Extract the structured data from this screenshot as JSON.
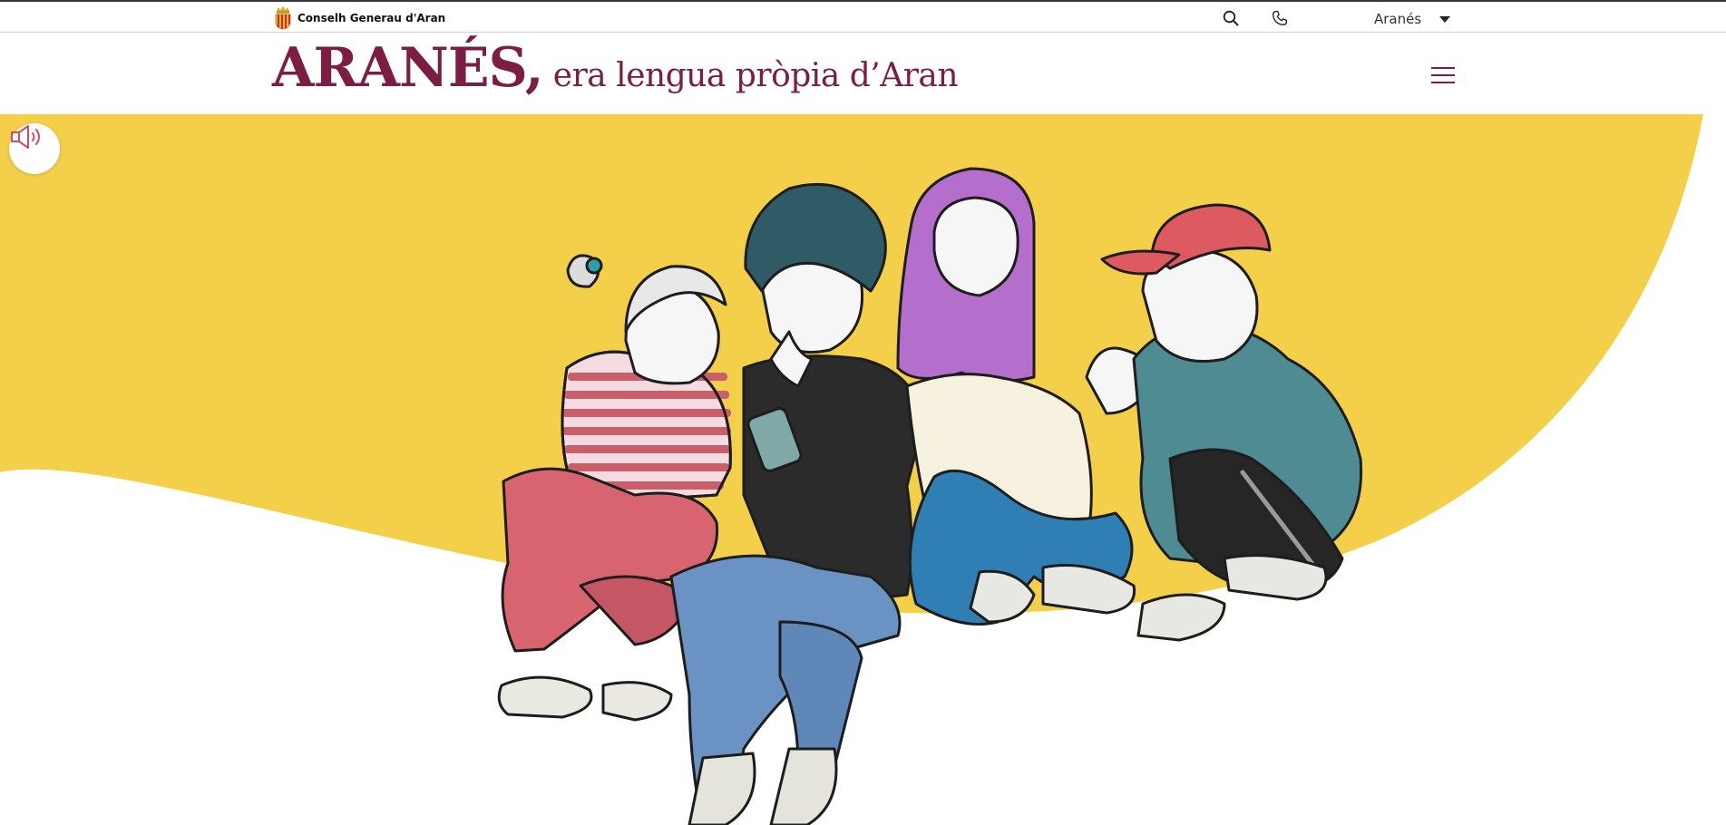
{
  "topbar": {
    "brand_name": "Conselh Generau d'Aran",
    "search_icon": "search-icon",
    "phone_icon": "phone-icon",
    "language": {
      "selected": "Aranés"
    }
  },
  "header": {
    "title_main": "ARANÉS,",
    "title_sub": "era lengua pròpia d’Aran",
    "menu_icon": "hamburger-menu-icon"
  },
  "hero": {
    "audio_icon": "speaker-icon",
    "illustration": "four-young-people-sitting-illustration"
  },
  "colors": {
    "brand": "#7e1d44",
    "hero_yellow": "#f4cf4a",
    "audio_icon": "#d8485f"
  }
}
